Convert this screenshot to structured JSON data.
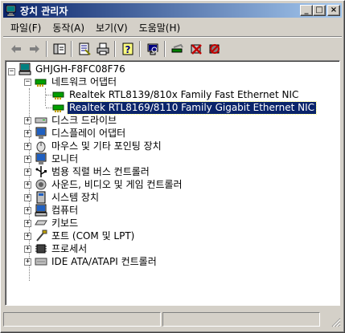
{
  "window": {
    "title": "장치 관리자",
    "controls": {
      "minimize": "_",
      "maximize": "□",
      "close": "×"
    }
  },
  "menu": [
    {
      "label": "파일(F)"
    },
    {
      "label": "동작(A)"
    },
    {
      "label": "보기(V)"
    },
    {
      "label": "도움말(H)"
    }
  ],
  "toolbar": [
    {
      "icon": "back-arrow-icon"
    },
    {
      "icon": "forward-arrow-icon"
    },
    {
      "icon": "show-hide-tree-icon"
    },
    {
      "icon": "properties-icon"
    },
    {
      "icon": "print-icon"
    },
    {
      "icon": "help-icon"
    },
    {
      "icon": "scan-hardware-icon"
    },
    {
      "icon": "update-driver-icon"
    },
    {
      "icon": "disable-device-icon"
    },
    {
      "icon": "uninstall-device-icon"
    }
  ],
  "tree": {
    "root": "GHJGH-F8FC08F76",
    "network_category": "네트워크 어댑터",
    "network_devices": [
      "Realtek RTL8139/810x Family Fast Ethernet NIC",
      "Realtek RTL8169/8110 Family Gigabit Ethernet NIC"
    ],
    "selected_device_index": 1,
    "categories": [
      "디스크 드라이브",
      "디스플레이 어댑터",
      "마우스 및 기타 포인팅 장치",
      "모니터",
      "범용 직렬 버스 컨트롤러",
      "사운드, 비디오 및 게임 컨트롤러",
      "시스템 장치",
      "컴퓨터",
      "키보드",
      "포트 (COM 및 LPT)",
      "프로세서",
      "IDE ATA/ATAPI 컨트롤러"
    ]
  },
  "colors": {
    "titlebar_start": "#0a246a",
    "titlebar_end": "#a6caf0",
    "selection": "#0a246a",
    "window_face": "#d4d0c8"
  }
}
